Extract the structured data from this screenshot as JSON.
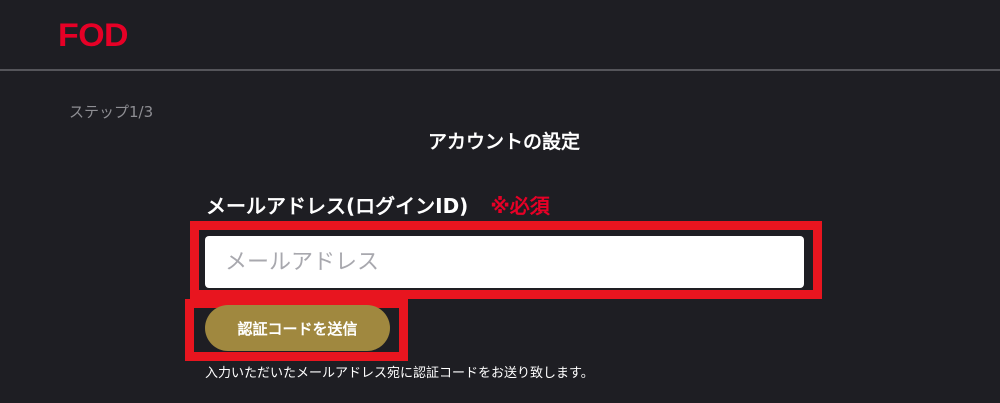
{
  "header": {
    "logo_text": "FOD"
  },
  "progress": {
    "step_label": "ステップ1/3"
  },
  "form": {
    "title": "アカウントの設定",
    "email_label": "メールアドレス(ログインID)",
    "required_label": "※必須",
    "email_value": "",
    "email_placeholder": "メールアドレス",
    "send_code_label": "認証コードを送信",
    "note": "入力いただいたメールアドレス宛に認証コードをお送り致します。"
  },
  "colors": {
    "background": "#1e1e23",
    "brand_red": "#e60026",
    "highlight_red": "#e8151f",
    "button_gold": "#a0883f"
  }
}
